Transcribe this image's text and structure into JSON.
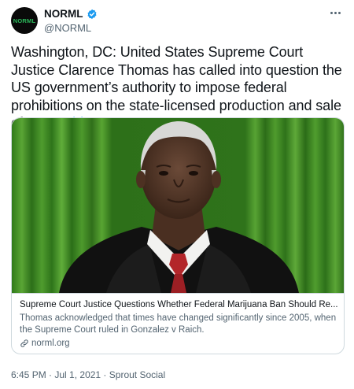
{
  "account": {
    "display_name": "NORML",
    "handle": "@NORML",
    "avatar_text": "NORML",
    "verified": true
  },
  "tweet": {
    "text_before_hashtag": "Washington, DC: United States Supreme Court Justice Clarence Thomas has called into question the US government’s authority to impose federal prohibitions on the state-licensed production and sale of ",
    "hashtag": "#cannabis",
    "text_after_hashtag": "."
  },
  "card": {
    "title": "Supreme Court Justice Questions Whether Federal Marijuana Ban Should Re...",
    "description": "Thomas acknowledged that times have changed significantly since 2005, when the Supreme Court ruled in Gonzalez v Raich.",
    "domain": "norml.org"
  },
  "meta": {
    "time": "6:45 PM",
    "separator": " · ",
    "date": "Jul 1, 2021",
    "source": "Sprout Social"
  },
  "colors": {
    "link_blue": "#1d9bf0",
    "verified_blue": "#1d9bf0",
    "secondary_text": "#536471",
    "avatar_green": "#2bb85a",
    "curtain_green": "#3f8f25"
  },
  "icons": {
    "verified": "verified-badge-icon",
    "more": "more-options-icon",
    "link": "link-icon"
  }
}
